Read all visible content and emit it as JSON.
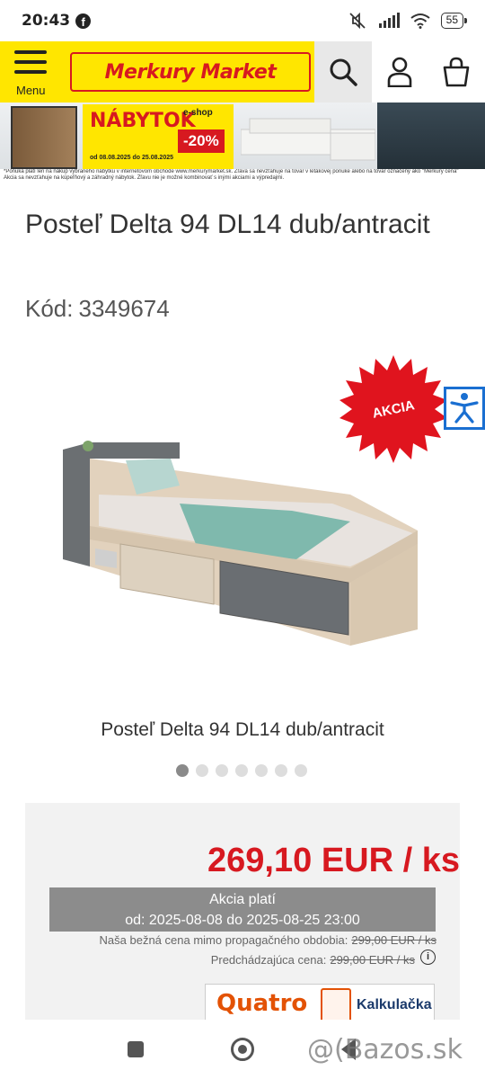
{
  "status_bar": {
    "time": "20:43",
    "battery": "55"
  },
  "header": {
    "menu_label": "Menu",
    "logo_text": "Merkury Market",
    "brand_yellow": "#ffe600",
    "brand_red": "#d71920"
  },
  "banner": {
    "title": "NÁBYTOK",
    "eshop": "e-shop",
    "discount": "-20%",
    "dates": "od 08.08.2025 do 25.08.2025",
    "fine_print_1": "*Ponuka platí len na nákup vybraného nábytku v internetovom obchode www.merkurymarket.sk. Zľava sa nevzťahuje na tovar v letákovej ponuke alebo na tovar označený ako \"Merkury cena\"",
    "fine_print_2": "Akcia sa nevzťahuje na kúpeľňový a záhradný nábytok. Zľavu nie je možné kombinovať s inými akciami a výpredajmi."
  },
  "product": {
    "title": "Posteľ Delta 94 DL14 dub/antracit",
    "code_label": "Kód:",
    "code_value": "3349674",
    "badge": "AKCIA",
    "caption": "Posteľ Delta 94 DL14 dub/antracit",
    "gallery_count": 7,
    "gallery_active": 1
  },
  "pricing": {
    "price": "269,10 EUR / ks",
    "promo_title": "Akcia platí",
    "promo_dates": "od: 2025-08-08 do 2025-08-25 23:00",
    "regular_label": "Naša bežná cena mimo propagačného obdobia:",
    "regular_value": "299,00 EUR / ks",
    "previous_label": "Predchádzajúca cena:",
    "previous_value": "299,00 EUR / ks",
    "info_icon": "info-icon"
  },
  "quatro": {
    "brand": "Quatro",
    "calc_label": "Kalkulačka"
  },
  "watermark": "@(Bazos.sk"
}
